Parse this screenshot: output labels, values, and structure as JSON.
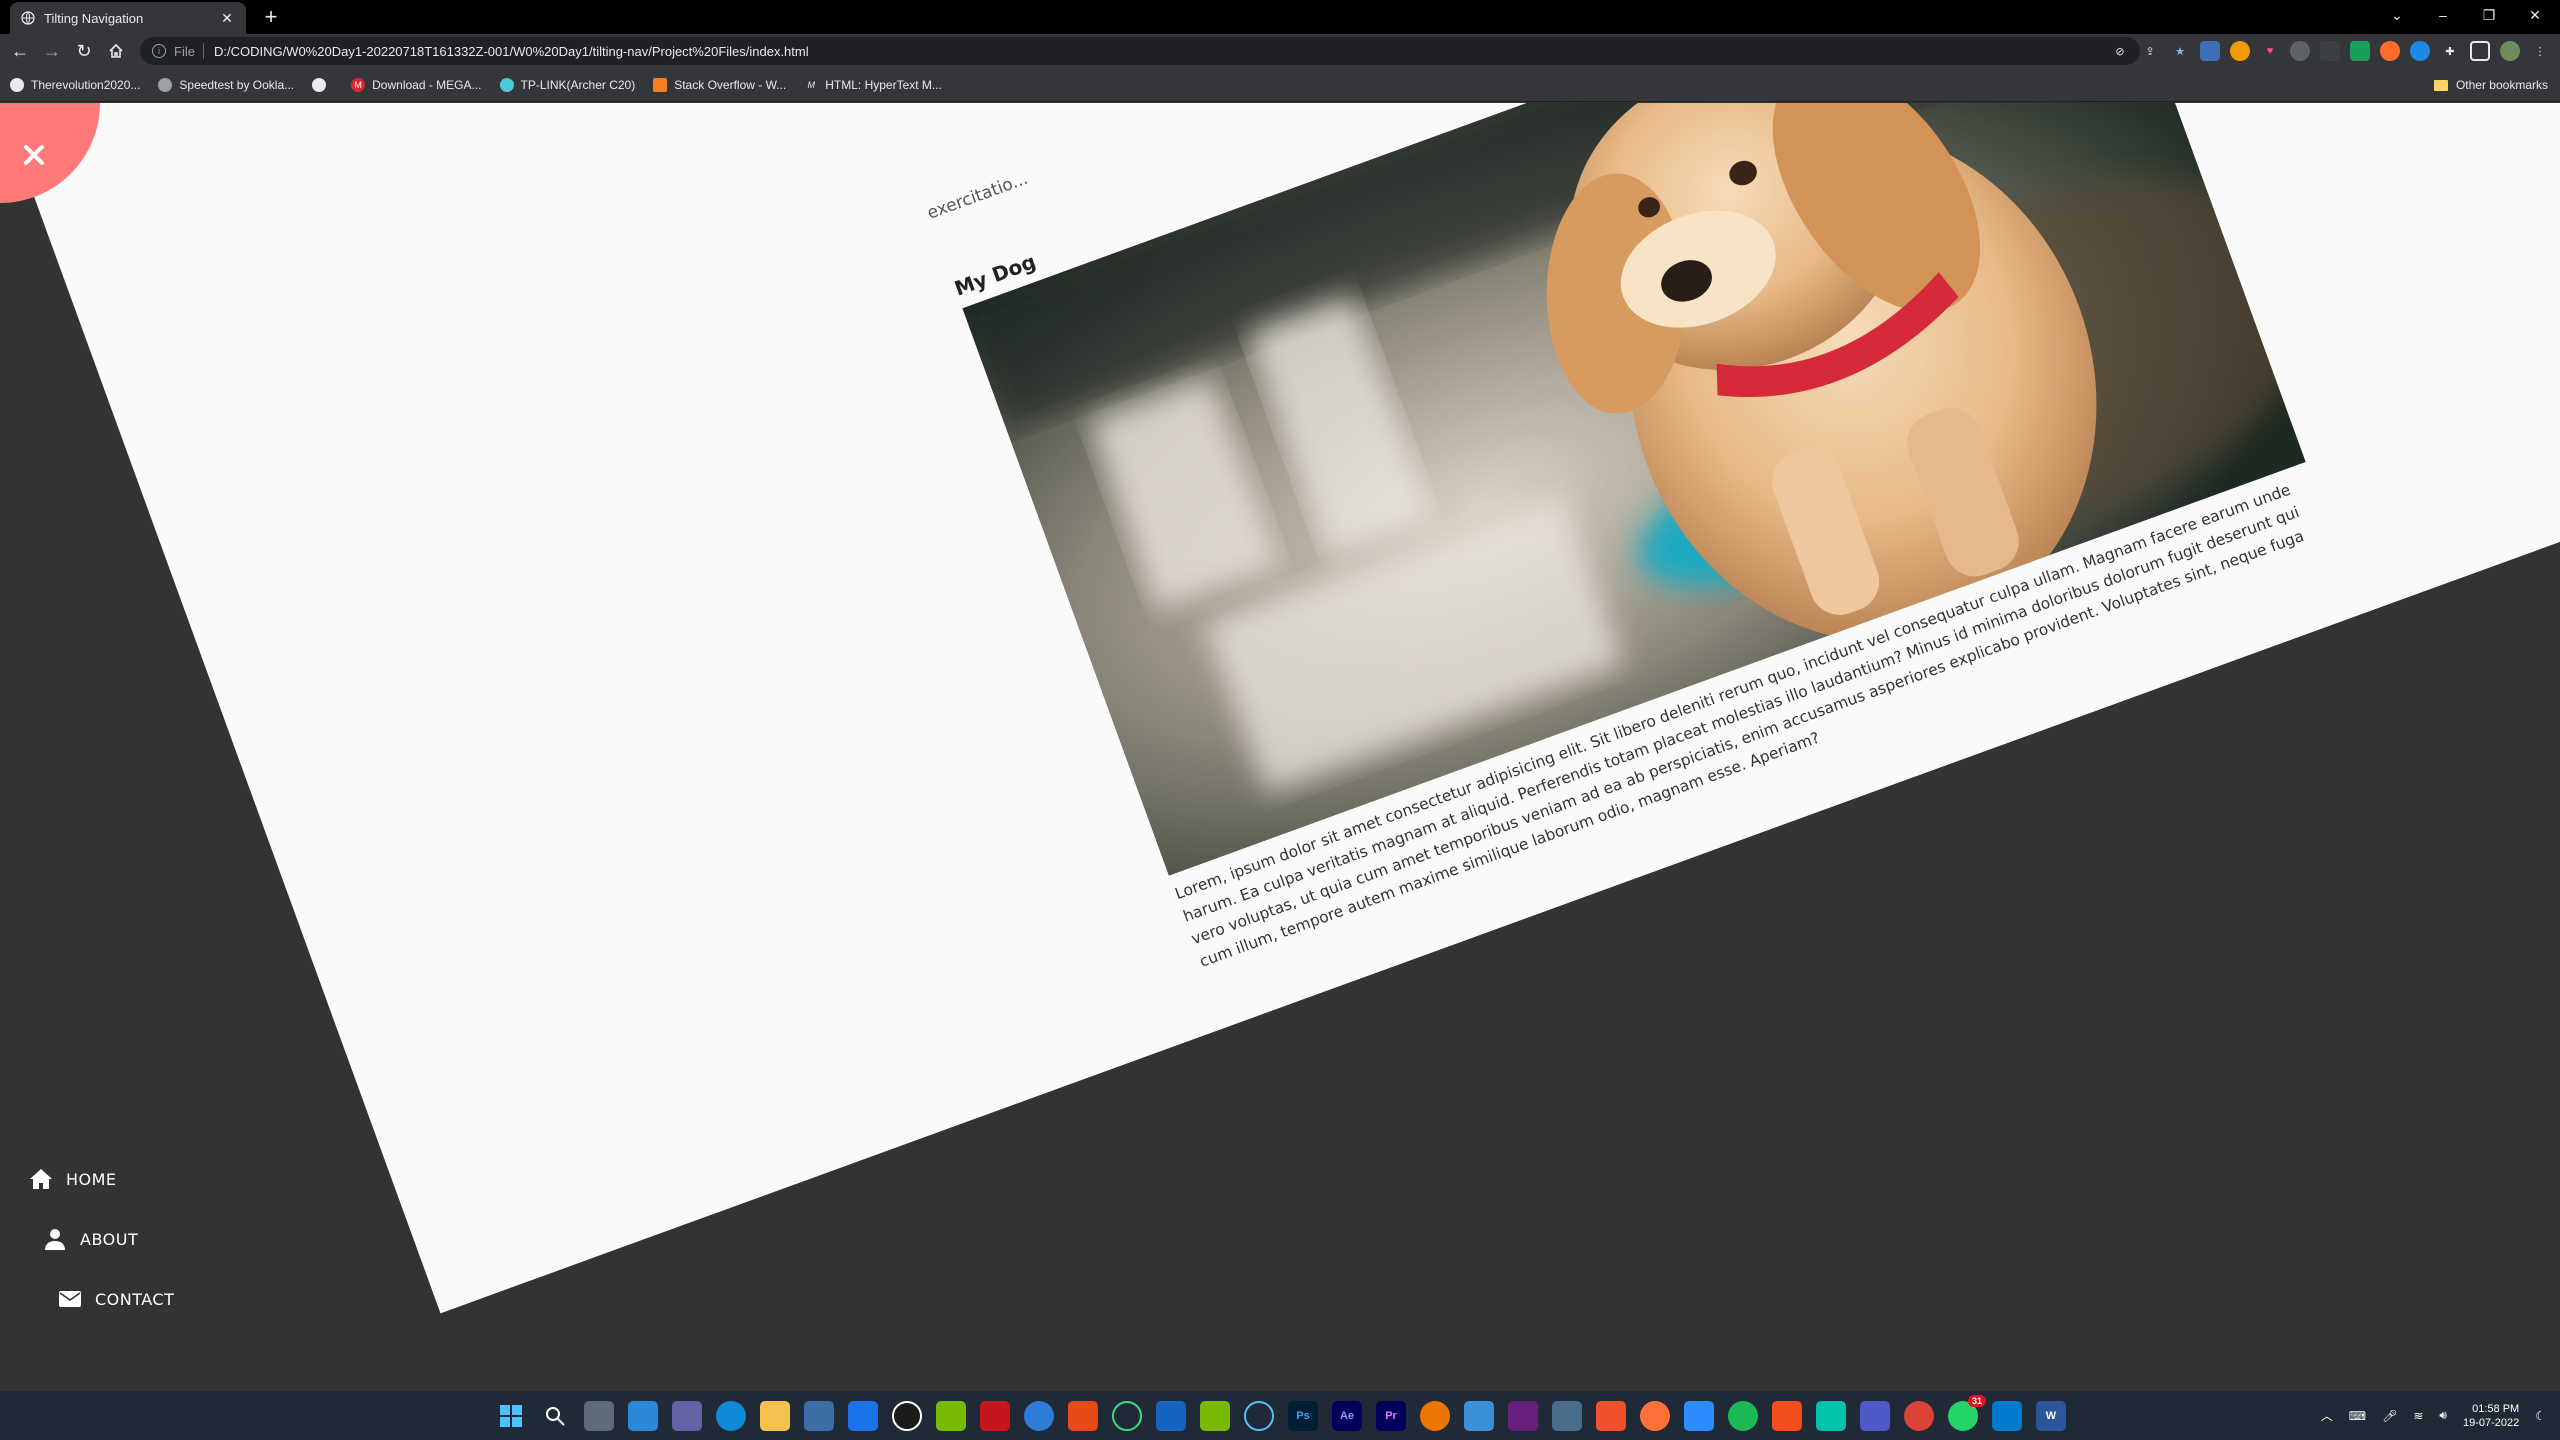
{
  "browser": {
    "tab_title": "Tilting Navigation",
    "tab_close": "✕",
    "new_tab": "+",
    "scheme": "File",
    "url": "D:/CODING/W0%20Day1-20220718T161332Z-001/W0%20Day1/tilting-nav/Project%20Files/index.html",
    "bookmarks": [
      {
        "label": "Therevolution2020...",
        "color": "#e8eaed"
      },
      {
        "label": "Speedtest by Ookla...",
        "color": "#9aa0a6"
      },
      {
        "label": "",
        "color": "#e8eaed"
      },
      {
        "label": "Download - MEGA...",
        "color": "#d9272e"
      },
      {
        "label": "TP-LINK(Archer C20)",
        "color": "#4acbd6"
      },
      {
        "label": "Stack Overflow - W...",
        "color": "#f48024"
      },
      {
        "label": "HTML: HyperText M...",
        "color": "#e8eaed"
      }
    ],
    "other_bookmarks": "Other bookmarks"
  },
  "page": {
    "clipped_text": "exercitatio...",
    "heading": "My Dog",
    "paragraph": "Lorem, ipsum dolor sit amet consectetur adipisicing elit. Sit libero deleniti rerum quo, incidunt vel consequatur culpa ullam. Magnam facere earum unde harum. Ea culpa veritatis magnam at aliquid. Perferendis totam placeat molestias illo laudantium? Minus id minima doloribus dolorum fugit deserunt qui vero voluptas, ut quia cum amet temporibus veniam ad ea ab perspiciatis, enim accusamus asperiores explicabo provident. Voluptates sint, neque fuga cum illum, tempore autem maxime similique laborum odio, magnam esse. Aperiam?",
    "accent_color": "#ff7979",
    "nav": [
      {
        "label": "HOME",
        "icon": "home-icon"
      },
      {
        "label": "ABOUT",
        "icon": "user-icon"
      },
      {
        "label": "CONTACT",
        "icon": "envelope-icon"
      }
    ]
  },
  "taskbar": {
    "time": "01:58 PM",
    "date": "19-07-2022",
    "whatsapp_badge": "31"
  }
}
